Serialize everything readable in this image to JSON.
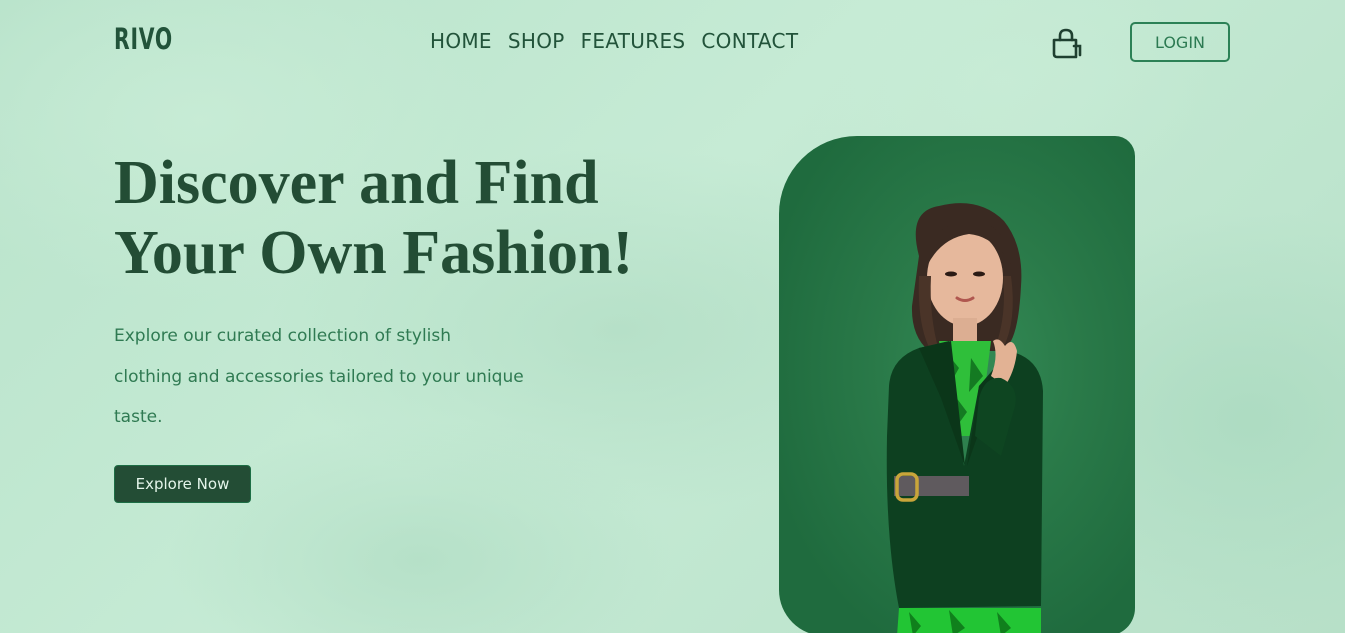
{
  "brand": {
    "logo_text": "RIVO"
  },
  "nav": {
    "items": [
      {
        "label": "HOME"
      },
      {
        "label": "SHOP"
      },
      {
        "label": "FEATURES"
      },
      {
        "label": "CONTACT"
      }
    ]
  },
  "header": {
    "cart_icon": "shopping-bag-icon",
    "login_label": "LOGIN"
  },
  "hero": {
    "title_line1": "Discover and Find",
    "title_line2": "Your Own Fashion!",
    "description": "Explore our curated collection of stylish clothing and accessories tailored to your unique taste.",
    "cta_label": "Explore Now",
    "image_subject": "woman in green blazer"
  },
  "colors": {
    "background": "#bfe6cf",
    "primary_dark": "#234d35",
    "accent": "#2c8156",
    "card_green": "#2a7a49"
  }
}
